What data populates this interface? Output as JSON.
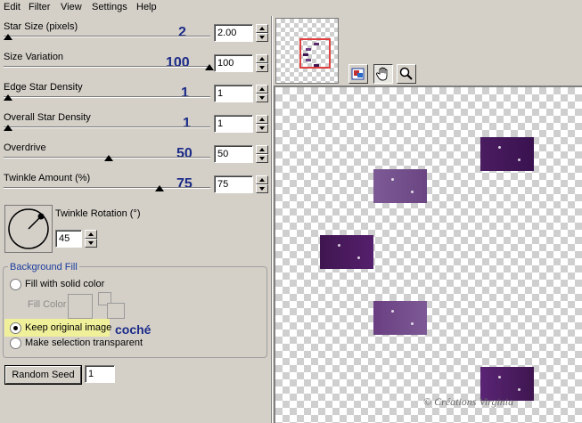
{
  "menu": [
    "Edit",
    "Filter",
    "View",
    "Settings",
    "Help"
  ],
  "params": [
    {
      "label": "Star Size (pixels)",
      "annotation": "2",
      "value": "2.00",
      "fraction": 0.0
    },
    {
      "label": "Size Variation",
      "annotation": "100",
      "value": "100",
      "fraction": 1.0
    },
    {
      "label": "Edge Star Density",
      "annotation": "1",
      "value": "1",
      "fraction": 0.0
    },
    {
      "label": "Overall Star Density",
      "annotation": "1",
      "value": "1",
      "fraction": 0.0
    },
    {
      "label": "Overdrive",
      "annotation": "50",
      "value": "50",
      "fraction": 0.5
    },
    {
      "label": "Twinkle Amount (%)",
      "annotation": "75",
      "value": "75",
      "fraction": 0.75
    }
  ],
  "rotation": {
    "label": "Twinkle Rotation (°)",
    "value": "45"
  },
  "background_fill": {
    "title": "Background Fill",
    "fill_solid": "Fill with solid color",
    "fill_color": "Fill Color",
    "keep_original": "Keep original image",
    "annotation": "coché",
    "make_transparent": "Make selection transparent",
    "selected": "keep_original"
  },
  "random_seed": {
    "label": "Random Seed",
    "value": "1"
  },
  "watermark": "© Créations Virginia",
  "colors": {
    "purple_dark": "#3f1650",
    "purple_mid": "#6a3f82",
    "purple_light": "#7d5a95",
    "highlight_yellow": "#f0ef9a",
    "annotation_blue": "#1b2b88"
  }
}
